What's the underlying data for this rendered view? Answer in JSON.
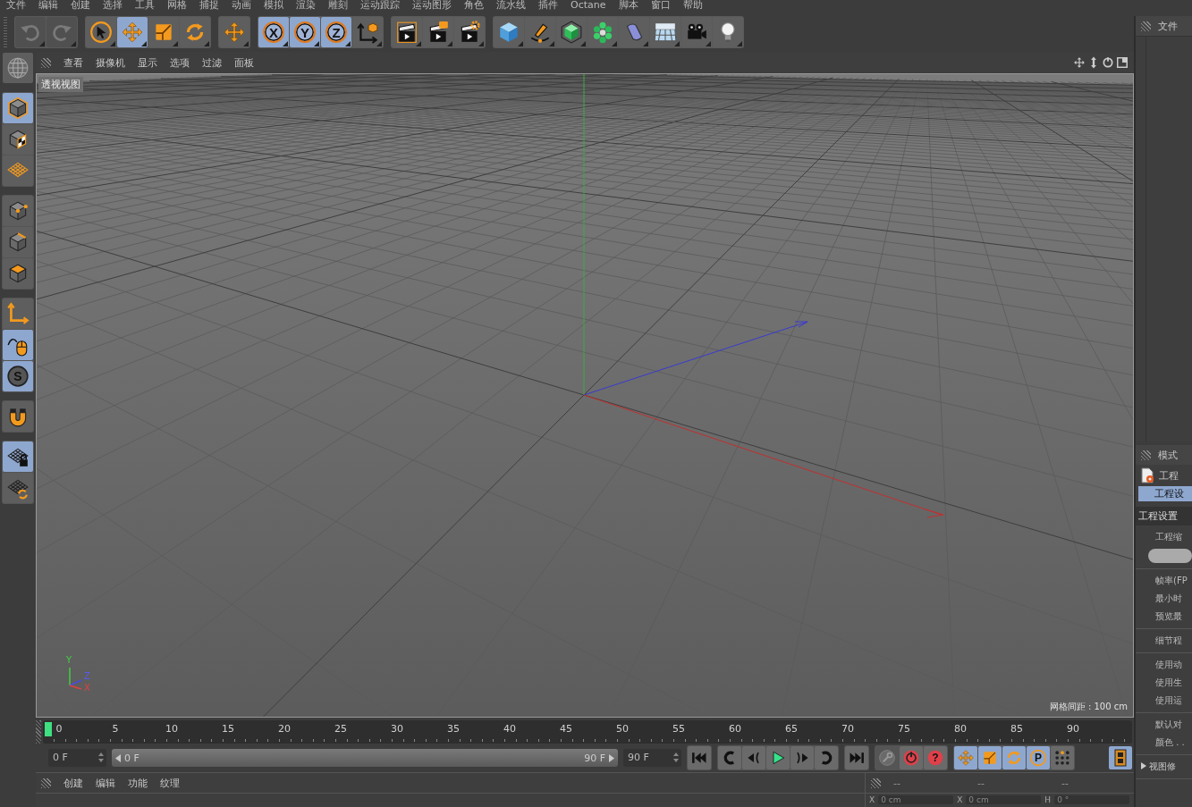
{
  "menu_bar": [
    "文件",
    "编辑",
    "创建",
    "选择",
    "工具",
    "网格",
    "捕捉",
    "动画",
    "模拟",
    "渲染",
    "雕刻",
    "运动跟踪",
    "运动图形",
    "角色",
    "流水线",
    "插件",
    "Octane",
    "脚本",
    "窗口",
    "帮助"
  ],
  "toolbar": [
    [
      {
        "kind": "undo",
        "disabled": true
      },
      {
        "kind": "redo",
        "disabled": true
      }
    ],
    [
      {
        "kind": "select",
        "selected": false
      },
      {
        "kind": "move",
        "selected": true
      },
      {
        "kind": "scale",
        "selected": false
      },
      {
        "kind": "rotate",
        "selected": false
      }
    ],
    [
      {
        "kind": "move",
        "selected": false
      }
    ],
    [
      {
        "kind": "axis-lock",
        "label": "X",
        "selected": true
      },
      {
        "kind": "axis-lock",
        "label": "Y",
        "selected": true
      },
      {
        "kind": "axis-lock",
        "label": "Z",
        "selected": true
      },
      {
        "kind": "coordinates",
        "selected": false
      }
    ],
    [
      {
        "kind": "render-view",
        "selected": false
      },
      {
        "kind": "render-picture",
        "selected": false
      },
      {
        "kind": "render-settings",
        "selected": false
      }
    ],
    [
      {
        "kind": "cube",
        "selected": false
      },
      {
        "kind": "pen",
        "selected": false
      },
      {
        "kind": "subdivision",
        "selected": false
      },
      {
        "kind": "cloner",
        "selected": false
      },
      {
        "kind": "bend",
        "selected": false
      },
      {
        "kind": "floor",
        "selected": false
      },
      {
        "kind": "camera",
        "selected": false
      },
      {
        "kind": "light",
        "selected": false
      }
    ]
  ],
  "mode_tools": [
    [
      {
        "kind": "view",
        "selected": false
      }
    ],
    [
      {
        "kind": "model",
        "selected": true
      },
      {
        "kind": "texture",
        "selected": false
      },
      {
        "kind": "workplane",
        "selected": false
      }
    ],
    [
      {
        "kind": "points",
        "selected": false
      },
      {
        "kind": "edges",
        "selected": false
      },
      {
        "kind": "polygons",
        "selected": false
      }
    ],
    [
      {
        "kind": "axis",
        "selected": false
      },
      {
        "kind": "tweak",
        "selected": true
      },
      {
        "kind": "solo",
        "label": "S",
        "selected": true
      }
    ],
    [
      {
        "kind": "snap",
        "selected": false
      }
    ],
    [
      {
        "kind": "workplane-lock",
        "selected": true
      },
      {
        "kind": "workplane-align",
        "selected": false
      }
    ]
  ],
  "viewport": {
    "menu": [
      "查看",
      "摄像机",
      "显示",
      "选项",
      "过滤",
      "面板"
    ],
    "title": "透视视图",
    "grid_spacing": "网格间距 : 100 cm",
    "axis_labels": {
      "y": "Y",
      "z": "Z",
      "x": "X"
    }
  },
  "timeline": {
    "ticks": [
      "0",
      "5",
      "10",
      "15",
      "20",
      "25",
      "30",
      "35",
      "40",
      "45",
      "50",
      "55",
      "60",
      "65",
      "70",
      "75",
      "80",
      "85",
      "90"
    ],
    "current_frame": "0 F",
    "range_start": "0 F",
    "range_end": "90 F",
    "end_frame": "90 F",
    "playback": [
      {
        "kind": "first"
      },
      {
        "kind": "prev-key"
      },
      {
        "kind": "prev-frame"
      },
      {
        "kind": "play"
      },
      {
        "kind": "next-frame"
      },
      {
        "kind": "next-key"
      },
      {
        "kind": "last"
      }
    ],
    "record": [
      {
        "kind": "key",
        "disabled": true
      },
      {
        "kind": "record",
        "disabled": false
      },
      {
        "kind": "auto-key",
        "label": "?",
        "disabled": false
      }
    ],
    "key_modes": [
      {
        "kind": "move",
        "selected": true
      },
      {
        "kind": "scale",
        "selected": true
      },
      {
        "kind": "rotate",
        "selected": true
      },
      {
        "kind": "parameter",
        "label": "P",
        "selected": true
      },
      {
        "kind": "points-grid",
        "selected": false
      }
    ],
    "scheme": {
      "selected": true
    }
  },
  "material_panel": {
    "menu": [
      "创建",
      "编辑",
      "功能",
      "纹理"
    ]
  },
  "coordinates_panel": {
    "headers": [
      "--",
      "--",
      "--"
    ],
    "fields": [
      {
        "axis": "X",
        "value": "0 cm"
      },
      {
        "axis": "X",
        "value": "0 cm"
      },
      {
        "axis": "H",
        "value": "0 °"
      }
    ]
  },
  "object_manager": {
    "menu": [
      "文件"
    ]
  },
  "attributes": {
    "menu": [
      "模式"
    ],
    "object": "工程",
    "tabs": [
      {
        "label": "工程设",
        "selected": true
      }
    ],
    "section": "工程设置",
    "groups": [
      [
        {
          "kind": "label",
          "text": "工程缩"
        },
        {
          "kind": "field"
        }
      ],
      [
        {
          "kind": "label",
          "text": "帧率(FP"
        },
        {
          "kind": "label",
          "text": "最小时"
        },
        {
          "kind": "label",
          "text": "预览最"
        }
      ],
      [
        {
          "kind": "label",
          "text": "细节程"
        }
      ],
      [
        {
          "kind": "label",
          "text": "使用动"
        },
        {
          "kind": "label",
          "text": "使用生"
        },
        {
          "kind": "label",
          "text": "使用运"
        }
      ],
      [
        {
          "kind": "label",
          "text": "默认对"
        },
        {
          "kind": "label",
          "text": "颜色 . ."
        }
      ],
      [
        {
          "kind": "group",
          "text": "视图修",
          "expanded": false
        }
      ]
    ]
  }
}
